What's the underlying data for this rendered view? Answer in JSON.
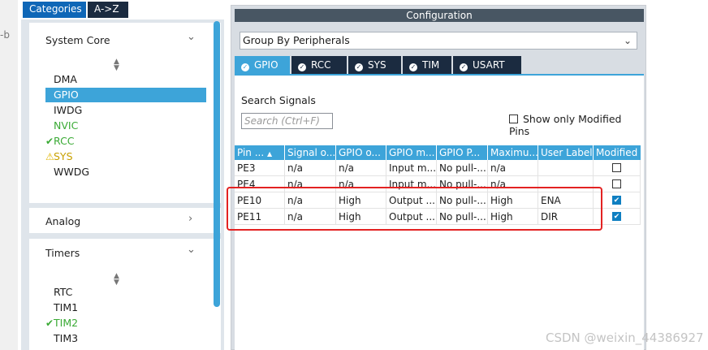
{
  "edge_text": "-b",
  "left": {
    "tabs": [
      "Categories",
      "A->Z"
    ],
    "system_core": {
      "title": "System Core",
      "items": [
        {
          "label": "DMA",
          "status": "none"
        },
        {
          "label": "GPIO",
          "status": "selected"
        },
        {
          "label": "IWDG",
          "status": "none"
        },
        {
          "label": "NVIC",
          "status": "green"
        },
        {
          "label": "RCC",
          "status": "check"
        },
        {
          "label": "SYS",
          "status": "warning"
        },
        {
          "label": "WWDG",
          "status": "none"
        }
      ]
    },
    "analog": {
      "title": "Analog"
    },
    "timers": {
      "title": "Timers",
      "items": [
        {
          "label": "RTC",
          "status": "none"
        },
        {
          "label": "TIM1",
          "status": "none"
        },
        {
          "label": "TIM2",
          "status": "check"
        },
        {
          "label": "TIM3",
          "status": "none"
        }
      ]
    }
  },
  "config": {
    "title": "Configuration",
    "dropdown_value": "Group By Peripherals",
    "tabs": [
      "GPIO",
      "RCC",
      "SYS",
      "TIM",
      "USART"
    ],
    "search_label": "Search Signals",
    "search_placeholder": "Search (Ctrl+F)",
    "show_modified_label": "Show only Modified Pins",
    "columns": [
      "Pin ...",
      "Signal o...",
      "GPIO o...",
      "GPIO m...",
      "GPIO P...",
      "Maximu...",
      "User Label",
      "Modified"
    ],
    "rows": [
      {
        "cells": [
          "PE3",
          "n/a",
          "n/a",
          "Input m...",
          "No pull-...",
          "n/a",
          ""
        ],
        "modified": false
      },
      {
        "cells": [
          "PE4",
          "n/a",
          "n/a",
          "Input m...",
          "No pull-...",
          "n/a",
          ""
        ],
        "modified": false
      },
      {
        "cells": [
          "PE10",
          "n/a",
          "High",
          "Output ...",
          "No pull-...",
          "High",
          "ENA"
        ],
        "modified": true
      },
      {
        "cells": [
          "PE11",
          "n/a",
          "High",
          "Output ...",
          "No pull-...",
          "High",
          "DIR"
        ],
        "modified": true
      }
    ]
  },
  "watermark": "CSDN @weixin_44386927",
  "colors": {
    "accent": "#3da4d9",
    "dark_tab": "#1b2b40",
    "highlight": "#e32222"
  }
}
